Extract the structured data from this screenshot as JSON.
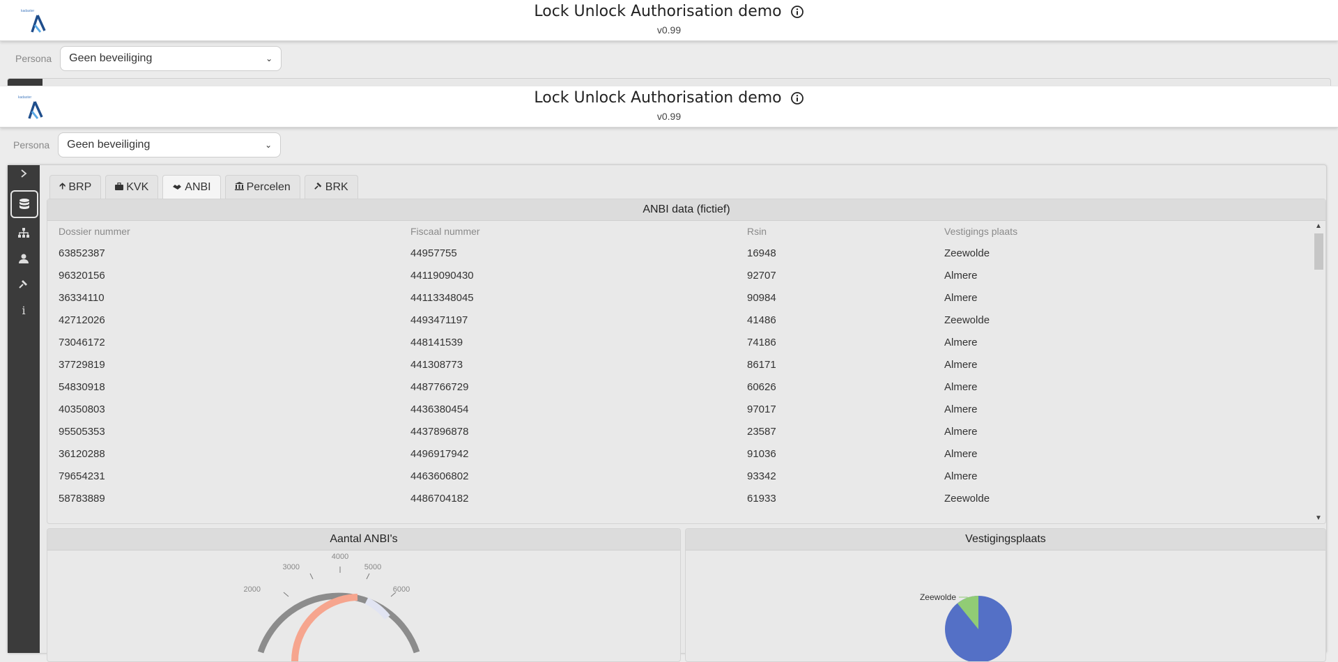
{
  "app": {
    "title": "Lock Unlock Authorisation demo",
    "version": "v0.99",
    "persona_label": "Persona",
    "persona_value": "Geen beveiliging"
  },
  "tabs": [
    {
      "label": "BRP",
      "icon": "arrow-up-icon"
    },
    {
      "label": "KVK",
      "icon": "briefcase-icon"
    },
    {
      "label": "ANBI",
      "icon": "handshake-icon"
    },
    {
      "label": "Percelen",
      "icon": "bank-icon"
    },
    {
      "label": "BRK",
      "icon": "hammer-icon"
    }
  ],
  "active_tab": "ANBI",
  "sidebar": {
    "items": [
      "database-icon",
      "sitemap-icon",
      "user-icon",
      "hammer-icon",
      "info-icon"
    ],
    "active": "database-icon"
  },
  "anbi_table": {
    "title": "ANBI data (fictief)",
    "columns": [
      "Dossier nummer",
      "Fiscaal nummer",
      "Rsin",
      "Vestigings plaats"
    ],
    "rows": [
      [
        "63852387",
        "44957755",
        "16948",
        "Zeewolde"
      ],
      [
        "96320156",
        "44119090430",
        "92707",
        "Almere"
      ],
      [
        "36334110",
        "44113348045",
        "90984",
        "Almere"
      ],
      [
        "42712026",
        "4493471197",
        "41486",
        "Zeewolde"
      ],
      [
        "73046172",
        "448141539",
        "74186",
        "Almere"
      ],
      [
        "37729819",
        "441308773",
        "86171",
        "Almere"
      ],
      [
        "54830918",
        "4487766729",
        "60626",
        "Almere"
      ],
      [
        "40350803",
        "4436380454",
        "97017",
        "Almere"
      ],
      [
        "95505353",
        "4437896878",
        "23587",
        "Almere"
      ],
      [
        "36120288",
        "4496917942",
        "91036",
        "Almere"
      ],
      [
        "79654231",
        "4463606802",
        "93342",
        "Almere"
      ],
      [
        "58783889",
        "4486704182",
        "61933",
        "Zeewolde"
      ]
    ]
  },
  "gauge_card": {
    "title": "Aantal ANBI's",
    "ticks": [
      "2000",
      "3000",
      "4000",
      "5000",
      "6000"
    ],
    "colors": {
      "arc": "#8c8c8c",
      "low": "#f6a58e",
      "high": "#e1e4f2"
    }
  },
  "pie_card": {
    "title": "Vestigingsplaats",
    "label": "Zeewolde",
    "colors": {
      "Almere": "#5470c6",
      "Zeewolde": "#91cc75"
    }
  }
}
